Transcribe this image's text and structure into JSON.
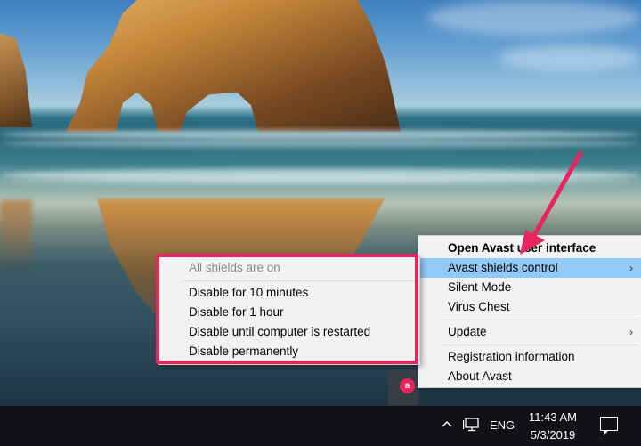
{
  "main_menu": {
    "items": [
      {
        "label": "Open Avast user interface",
        "bold": true
      },
      {
        "label": "Avast shields control",
        "has_submenu": true,
        "highlighted": true
      },
      {
        "label": "Silent Mode"
      },
      {
        "label": "Virus Chest"
      },
      {
        "label": "Update",
        "has_submenu": true
      },
      {
        "label": "Registration information"
      },
      {
        "label": "About Avast"
      }
    ],
    "chevron": "›"
  },
  "sub_menu": {
    "status": "All shields are on",
    "items": [
      {
        "label": "Disable for 10 minutes"
      },
      {
        "label": "Disable for 1 hour"
      },
      {
        "label": "Disable until computer is restarted"
      },
      {
        "label": "Disable permanently"
      }
    ]
  },
  "taskbar": {
    "language": "ENG",
    "time": "11:43 AM",
    "date": "5/3/2019"
  },
  "icons": {
    "tray_overflow": "chevron-up-icon",
    "network": "monitor-network-icon",
    "notifications": "speech-bubble-icon",
    "avast": "avast-tray-icon"
  },
  "colors": {
    "highlight": "#91c9f7",
    "annotation": "#e8245f",
    "taskbar": "#101218",
    "menu_bg": "#f2f2f2"
  }
}
